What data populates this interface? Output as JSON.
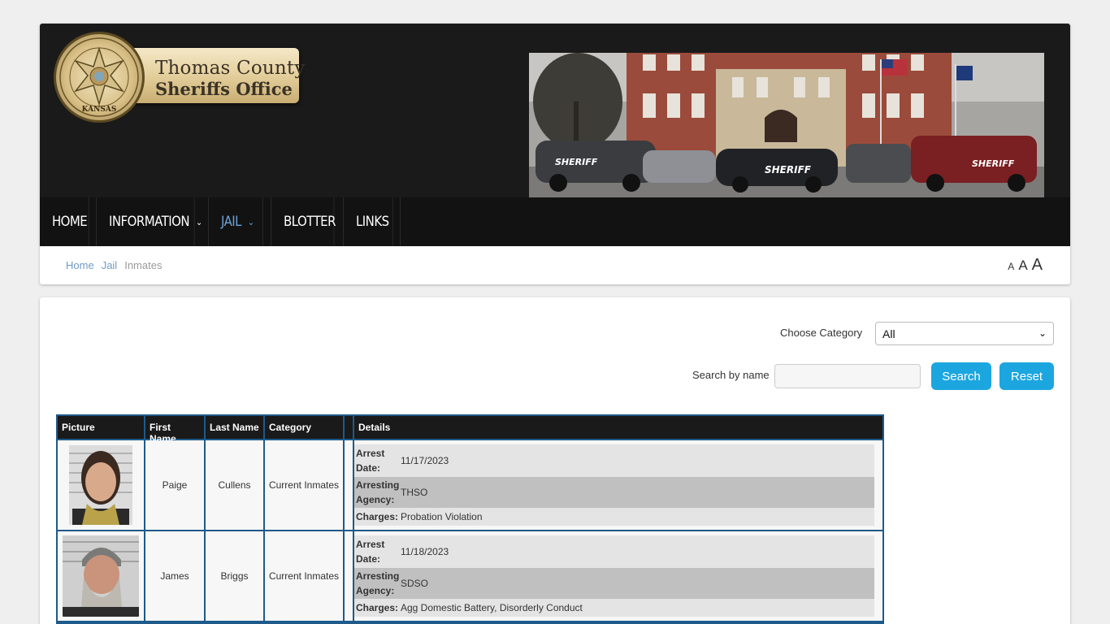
{
  "logo": {
    "line1": "Thomas County",
    "line2": "Sheriffs Office",
    "seal_top": "THOMAS COUNTY SHERIFF'S OFFICE",
    "seal_bottom": "KANSAS"
  },
  "nav": {
    "items": [
      {
        "label": "HOME",
        "dropdown": false,
        "active": false
      },
      {
        "label": "INFORMATION",
        "dropdown": true,
        "active": false
      },
      {
        "label": "JAIL",
        "dropdown": true,
        "active": true
      },
      {
        "label": "BLOTTER",
        "dropdown": false,
        "active": false
      },
      {
        "label": "LINKS",
        "dropdown": false,
        "active": false
      }
    ]
  },
  "breadcrumb": {
    "home": "Home",
    "jail": "Jail",
    "current": "Inmates"
  },
  "font_sizer": {
    "small": "A",
    "medium": "A",
    "large": "A"
  },
  "filters": {
    "category_label": "Choose Category",
    "category_value": "All",
    "search_label": "Search by name",
    "search_placeholder": "",
    "search_button": "Search",
    "reset_button": "Reset"
  },
  "table": {
    "headers": {
      "picture": "Picture",
      "first_name": "First Name",
      "last_name": "Last Name",
      "category": "Category",
      "details": "Details"
    },
    "detail_labels": {
      "arrest_date": "Arrest Date:",
      "agency": "Arresting Agency:",
      "charges": "Charges:"
    },
    "rows": [
      {
        "first": "Paige",
        "last": "Cullens",
        "category": "Current Inmates",
        "arrest_date": "11/17/2023",
        "agency": "THSO",
        "charges": "Probation Violation"
      },
      {
        "first": "James",
        "last": "Briggs",
        "category": "Current Inmates",
        "arrest_date": "11/18/2023",
        "agency": "SDSO",
        "charges": "Agg Domestic Battery, Disorderly Conduct"
      }
    ]
  },
  "colors": {
    "accent": "#1ca6e0",
    "nav_active": "#6fa3d8",
    "table_border": "#1e5a8a"
  }
}
